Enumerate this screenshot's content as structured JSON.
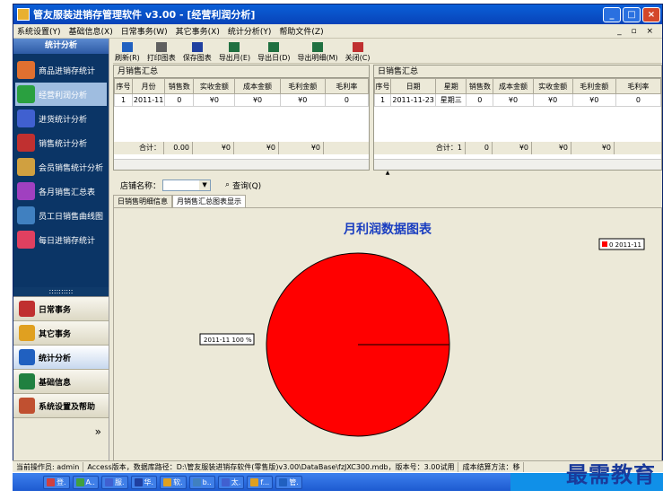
{
  "window": {
    "title": "管友服装进销存管理软件 v3.00 - [经营利润分析]"
  },
  "menu": [
    "系统设置(Y)",
    "基础信息(X)",
    "日常事务(W)",
    "其它事务(X)",
    "统计分析(Y)",
    "帮助文件(Z)"
  ],
  "mdi_controls": "_ ▫ ×",
  "sidebar": {
    "header": "统计分析",
    "items": [
      {
        "label": "商品进销存统计",
        "icon": "#e07030"
      },
      {
        "label": "经营利润分析",
        "icon": "#2aa040"
      },
      {
        "label": "进货统计分析",
        "icon": "#4060d0"
      },
      {
        "label": "销售统计分析",
        "icon": "#c03030"
      },
      {
        "label": "会员销售统计分析",
        "icon": "#d0a040"
      },
      {
        "label": "各月销售汇总表",
        "icon": "#a040c0"
      },
      {
        "label": "员工日销售曲线图",
        "icon": "#4080c0"
      },
      {
        "label": "每日进销存统计",
        "icon": "#e04060"
      }
    ],
    "dots": "::::::::::",
    "sections": [
      {
        "label": "日常事务",
        "icon": "#c03030"
      },
      {
        "label": "其它事务",
        "icon": "#e0a020"
      },
      {
        "label": "统计分析",
        "icon": "#2060c0"
      },
      {
        "label": "基础信息",
        "icon": "#208040"
      },
      {
        "label": "系统设置及帮助",
        "icon": "#c05030"
      }
    ],
    "more": "»"
  },
  "toolbar": [
    {
      "label": "刷新(R)",
      "icon": "#2060c0"
    },
    {
      "label": "打印图表",
      "icon": "#606060"
    },
    {
      "label": "保存图表",
      "icon": "#2040a0"
    },
    {
      "label": "导出月(E)",
      "icon": "#207040"
    },
    {
      "label": "导出日(D)",
      "icon": "#207040"
    },
    {
      "label": "导出明细(M)",
      "icon": "#207040"
    },
    {
      "label": "关闭(C)",
      "icon": "#c03030"
    }
  ],
  "monthly": {
    "tab": "月销售汇总",
    "columns": [
      "序号",
      "月份",
      "销售数",
      "实收金额",
      "成本金额",
      "毛利金额",
      "毛利率"
    ],
    "rows": [
      [
        "1",
        "2011-11",
        "0",
        "¥0",
        "¥0",
        "¥0",
        "0"
      ]
    ],
    "total_label": "合计：",
    "totals": [
      "0.00",
      "¥0",
      "¥0",
      "¥0"
    ]
  },
  "daily": {
    "tab": "日销售汇总",
    "columns": [
      "序号",
      "日期",
      "星期",
      "销售数",
      "成本金额",
      "实收金额",
      "毛利金额",
      "毛利率"
    ],
    "rows": [
      [
        "1",
        "2011-11-23",
        "星期三",
        "0",
        "¥0",
        "¥0",
        "¥0",
        "0"
      ]
    ],
    "total_label": "合计：1",
    "totals": [
      "0",
      "¥0",
      "¥0",
      "¥0"
    ]
  },
  "filter": {
    "store_label": "店铺名称：",
    "store_value": "",
    "query": "查询(Q)"
  },
  "subtabs": [
    "日销售明细信息",
    "月销售汇总图表显示"
  ],
  "chart_data": {
    "type": "pie",
    "title": "月利润数据图表",
    "categories": [
      "2011-11"
    ],
    "values": [
      100
    ],
    "slice_label": "2011-11 100 %",
    "legend": [
      {
        "label": "0 2011-11",
        "color": "#ff0000"
      }
    ],
    "legend_position": "top-right",
    "colors": [
      "#ff0000"
    ]
  },
  "status": {
    "operator": "当前操作员: admin",
    "db": "Access版本，数据库路径：D:\\管友服装进销存软件(零售版)v3.00\\DataBase\\fzJXC300.mdb，版本号：3.00试用",
    "cost": "成本结算方法：移"
  },
  "taskbar": [
    {
      "label": "登.",
      "color": "#d04040"
    },
    {
      "label": "A..",
      "color": "#40a040"
    },
    {
      "label": "服.",
      "color": "#4060d0"
    },
    {
      "label": "华.",
      "color": "#2040a0"
    },
    {
      "label": "软.",
      "color": "#e0a020"
    },
    {
      "label": "b..",
      "color": "#4080c0"
    },
    {
      "label": "太.",
      "color": "#4060d0"
    },
    {
      "label": "f...",
      "color": "#e0a020"
    },
    {
      "label": "管.",
      "color": "#2060c0"
    }
  ],
  "watermark": "最需教育"
}
